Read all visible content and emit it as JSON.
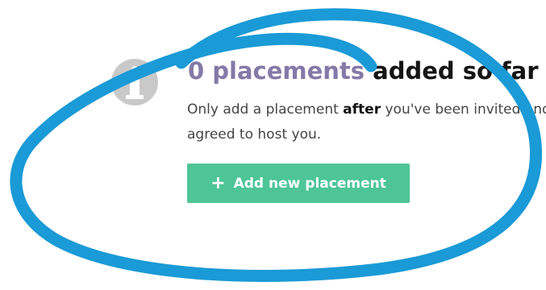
{
  "placements": {
    "count_text": "0 placements",
    "headline_rest": " added so far",
    "description_before": "Only add a placement ",
    "description_emphasis": "after",
    "description_after": " you've been invited and agreed to host you.",
    "add_button": {
      "icon": "plus-icon",
      "icon_glyph": "+",
      "label": "Add new placement"
    }
  },
  "colors": {
    "count_text": "#8479a7",
    "button_bg": "#4ec596",
    "icon_gray": "#c9c9c9",
    "annotation_stroke": "#1a9ad6"
  }
}
